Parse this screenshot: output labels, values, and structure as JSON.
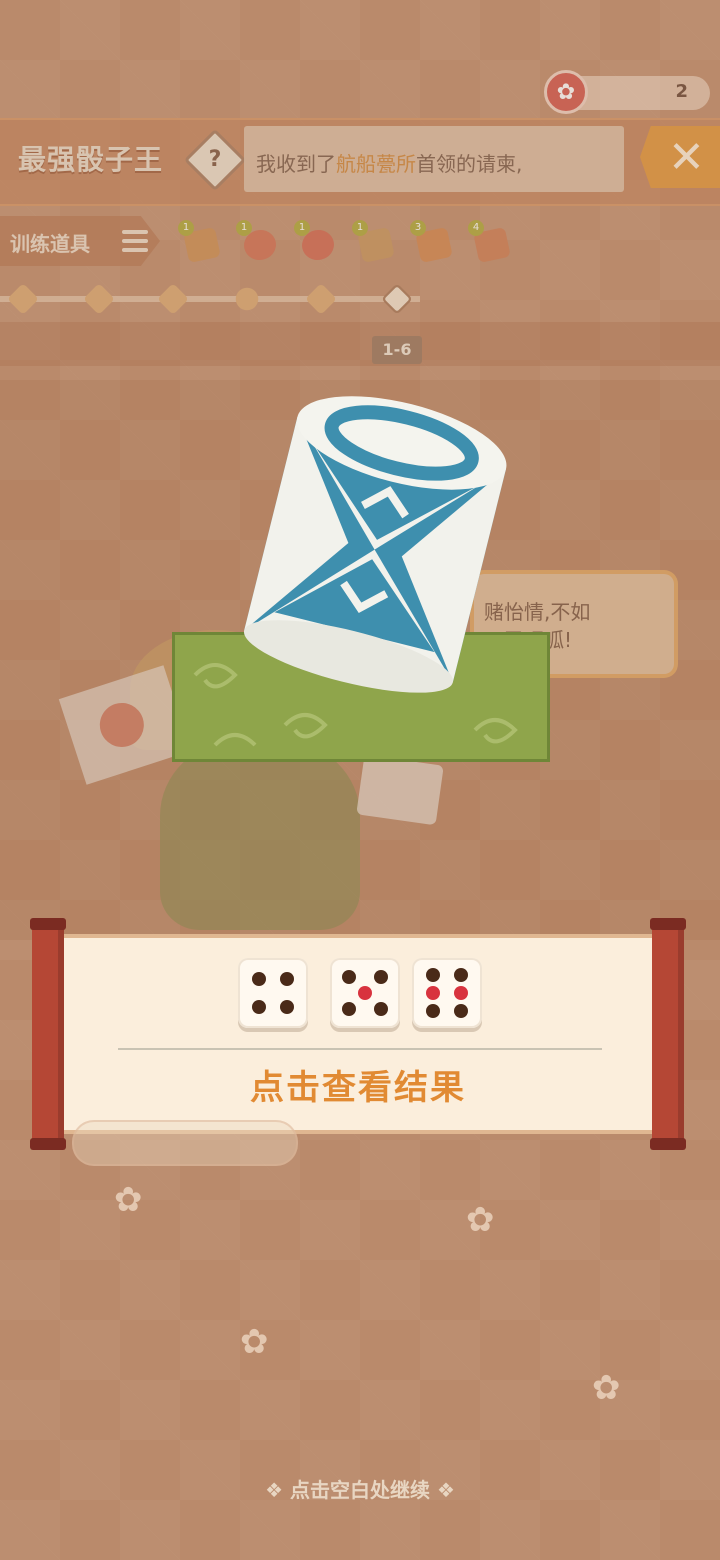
{
  "counter": {
    "value": "2",
    "icon": "plum-flower-icon"
  },
  "header": {
    "title": "最强骰子王",
    "help_label": "?",
    "dialog_prefix": "我收到了",
    "dialog_highlight": "航船甍所",
    "dialog_suffix": "首领的请柬,",
    "close_label": "✕"
  },
  "training": {
    "label": "训练道具",
    "items": [
      {
        "badge": "1"
      },
      {
        "badge": "1"
      },
      {
        "badge": "1"
      },
      {
        "badge": "1"
      },
      {
        "badge": "3"
      },
      {
        "badge": "4"
      }
    ]
  },
  "progress": {
    "stage": "1-6"
  },
  "scene": {
    "speech_line1": "赌怡情,不如",
    "speech_line2": "…了吧呱!"
  },
  "result": {
    "dice": [
      4,
      5,
      6
    ],
    "button_label": "点击查看结果"
  },
  "footer": {
    "continue_label": "点击空白处继续"
  }
}
